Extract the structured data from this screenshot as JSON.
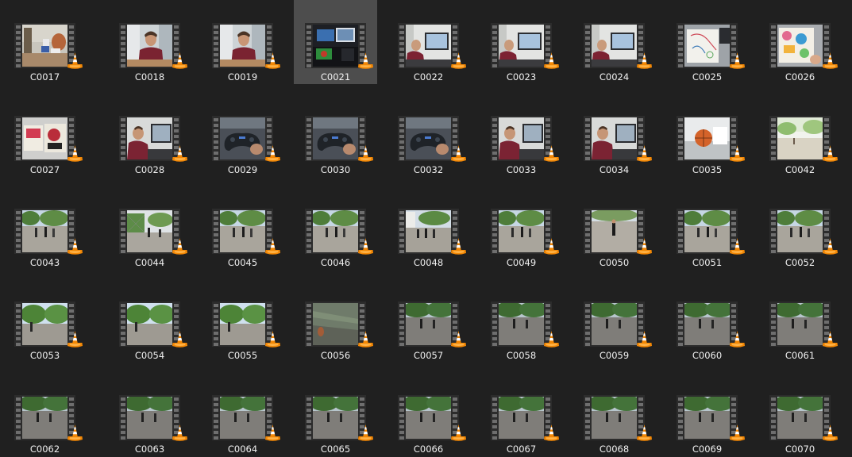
{
  "view": "large-icons",
  "selected_item": "C0021",
  "items": [
    {
      "name": "C0017",
      "icon": "vlc-cone-icon",
      "thumb": "kitchen-table"
    },
    {
      "name": "C0018",
      "icon": "vlc-cone-icon",
      "thumb": "man-talking"
    },
    {
      "name": "C0019",
      "icon": "vlc-cone-icon",
      "thumb": "man-talking"
    },
    {
      "name": "C0021",
      "icon": "vlc-cone-icon",
      "thumb": "monitors-dark"
    },
    {
      "name": "C0022",
      "icon": "vlc-cone-icon",
      "thumb": "man-at-desk"
    },
    {
      "name": "C0023",
      "icon": "vlc-cone-icon",
      "thumb": "man-at-desk"
    },
    {
      "name": "C0024",
      "icon": "vlc-cone-icon",
      "thumb": "man-at-desk"
    },
    {
      "name": "C0025",
      "icon": "vlc-cone-icon",
      "thumb": "drawing-paper"
    },
    {
      "name": "C0026",
      "icon": "vlc-cone-icon",
      "thumb": "drawing-color"
    },
    {
      "name": "C0027",
      "icon": "vlc-cone-icon",
      "thumb": "books"
    },
    {
      "name": "C0028",
      "icon": "vlc-cone-icon",
      "thumb": "man-gaming"
    },
    {
      "name": "C0029",
      "icon": "vlc-cone-icon",
      "thumb": "controller"
    },
    {
      "name": "C0030",
      "icon": "vlc-cone-icon",
      "thumb": "controller"
    },
    {
      "name": "C0032",
      "icon": "vlc-cone-icon",
      "thumb": "controller"
    },
    {
      "name": "C0033",
      "icon": "vlc-cone-icon",
      "thumb": "man-gaming"
    },
    {
      "name": "C0034",
      "icon": "vlc-cone-icon",
      "thumb": "man-gaming"
    },
    {
      "name": "C0035",
      "icon": "vlc-cone-icon",
      "thumb": "basketball"
    },
    {
      "name": "C0042",
      "icon": "vlc-cone-icon",
      "thumb": "court-bright"
    },
    {
      "name": "C0043",
      "icon": "vlc-cone-icon",
      "thumb": "court-players"
    },
    {
      "name": "C0044",
      "icon": "vlc-cone-icon",
      "thumb": "court-fence"
    },
    {
      "name": "C0045",
      "icon": "vlc-cone-icon",
      "thumb": "court-players"
    },
    {
      "name": "C0046",
      "icon": "vlc-cone-icon",
      "thumb": "court-players"
    },
    {
      "name": "C0048",
      "icon": "vlc-cone-icon",
      "thumb": "court-buildings"
    },
    {
      "name": "C0049",
      "icon": "vlc-cone-icon",
      "thumb": "court-players"
    },
    {
      "name": "C0050",
      "icon": "vlc-cone-icon",
      "thumb": "court-player"
    },
    {
      "name": "C0051",
      "icon": "vlc-cone-icon",
      "thumb": "court-players"
    },
    {
      "name": "C0052",
      "icon": "vlc-cone-icon",
      "thumb": "court-players"
    },
    {
      "name": "C0053",
      "icon": "vlc-cone-icon",
      "thumb": "court-trees"
    },
    {
      "name": "C0054",
      "icon": "vlc-cone-icon",
      "thumb": "court-trees"
    },
    {
      "name": "C0055",
      "icon": "vlc-cone-icon",
      "thumb": "court-trees"
    },
    {
      "name": "C0056",
      "icon": "vlc-cone-icon",
      "thumb": "court-blur"
    },
    {
      "name": "C0057",
      "icon": "vlc-cone-icon",
      "thumb": "court-evening"
    },
    {
      "name": "C0058",
      "icon": "vlc-cone-icon",
      "thumb": "court-evening"
    },
    {
      "name": "C0059",
      "icon": "vlc-cone-icon",
      "thumb": "court-evening"
    },
    {
      "name": "C0060",
      "icon": "vlc-cone-icon",
      "thumb": "court-evening"
    },
    {
      "name": "C0061",
      "icon": "vlc-cone-icon",
      "thumb": "court-evening"
    },
    {
      "name": "C0062",
      "icon": "vlc-cone-icon",
      "thumb": "court-evening"
    },
    {
      "name": "C0063",
      "icon": "vlc-cone-icon",
      "thumb": "court-evening"
    },
    {
      "name": "C0064",
      "icon": "vlc-cone-icon",
      "thumb": "court-evening"
    },
    {
      "name": "C0065",
      "icon": "vlc-cone-icon",
      "thumb": "court-evening"
    },
    {
      "name": "C0066",
      "icon": "vlc-cone-icon",
      "thumb": "court-evening"
    },
    {
      "name": "C0067",
      "icon": "vlc-cone-icon",
      "thumb": "court-evening"
    },
    {
      "name": "C0068",
      "icon": "vlc-cone-icon",
      "thumb": "court-evening"
    },
    {
      "name": "C0069",
      "icon": "vlc-cone-icon",
      "thumb": "court-evening"
    },
    {
      "name": "C0070",
      "icon": "vlc-cone-icon",
      "thumb": "court-evening"
    }
  ],
  "colors": {
    "background": "#202020",
    "selection": "#4d4d4d",
    "label_text": "#f0f0f0",
    "vlc_orange": "#f28705"
  }
}
